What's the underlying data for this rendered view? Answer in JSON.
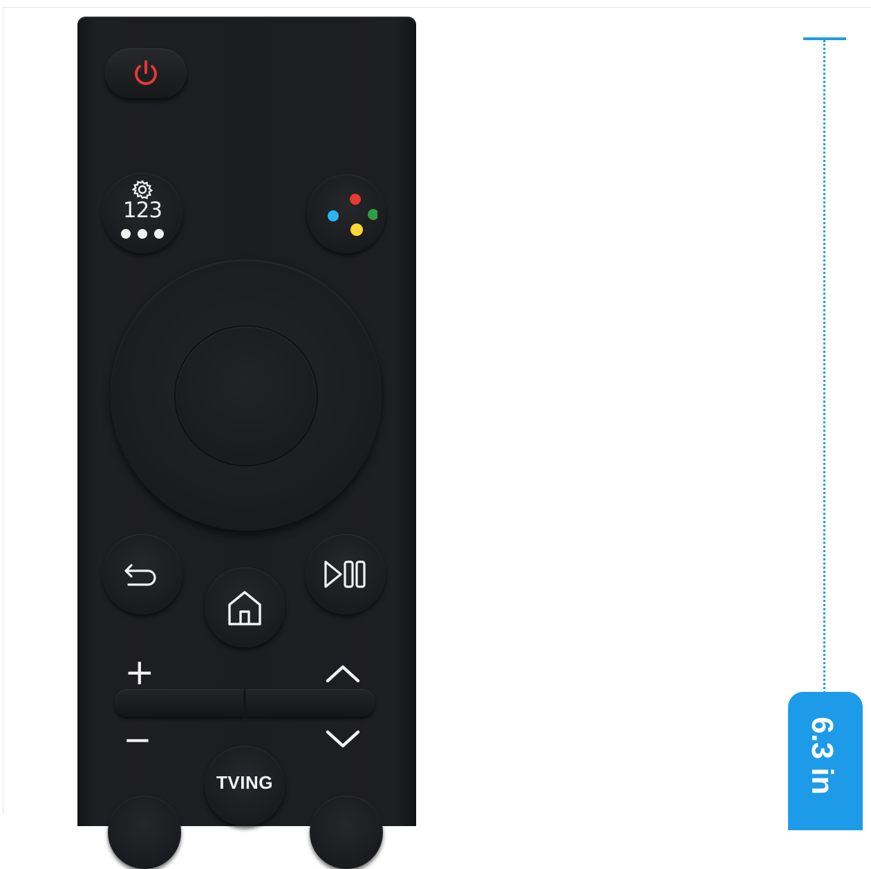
{
  "remote": {
    "buttons": {
      "power": "power-icon",
      "number_pad": "123",
      "color_buttons": [
        "#e53935",
        "#2e9e44",
        "#29b6f6",
        "#fdd835"
      ],
      "back": "back-icon",
      "home": "home-icon",
      "play_pause": "play-pause-icon",
      "volume_up": "+",
      "volume_down": "−",
      "channel_up": "channel-up-icon",
      "channel_down": "channel-down-icon",
      "tving": "TVING"
    },
    "power_color": "#e53935"
  },
  "dimension": {
    "label": "6.3 in",
    "color": "#1e9be8"
  }
}
